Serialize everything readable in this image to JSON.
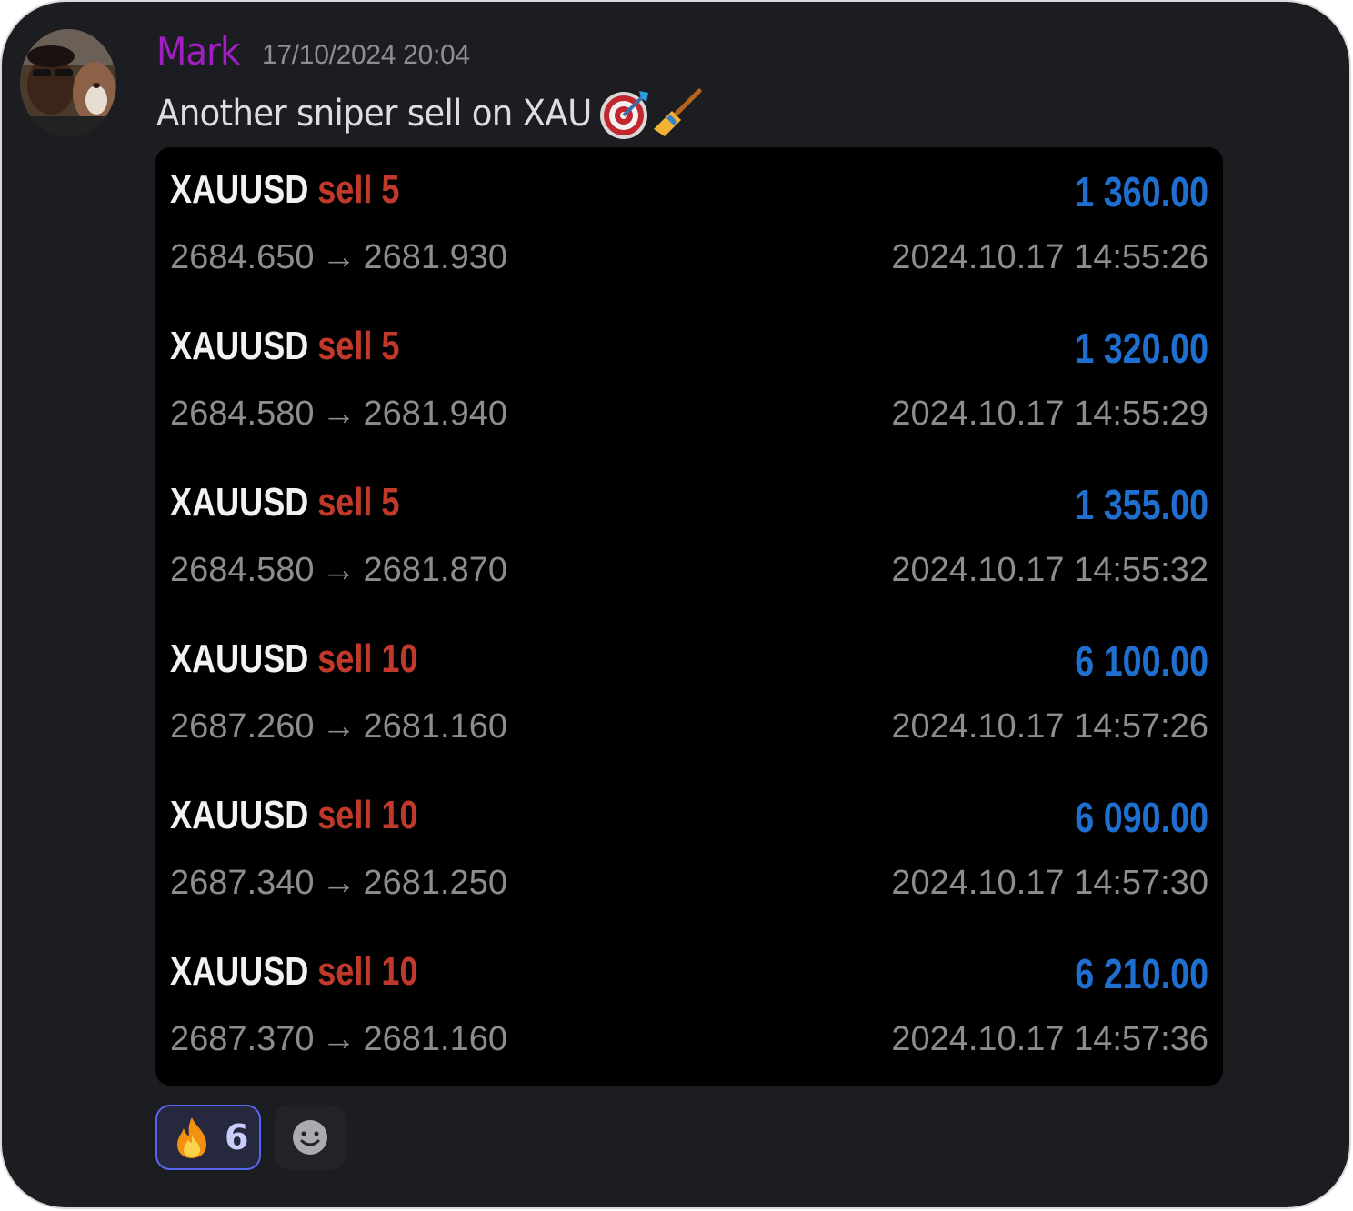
{
  "author": {
    "name": "Mark",
    "timestamp": "17/10/2024 20:04"
  },
  "message": {
    "text": "Another sniper sell on XAU",
    "emojis": [
      "direct-hit-emoji",
      "broom-emoji"
    ]
  },
  "trades": [
    {
      "symbol": "XAUUSD",
      "side": "sell 5",
      "profit": "1 360.00",
      "open": "2684.650",
      "arrow": "→",
      "close": "2681.930",
      "time": "2024.10.17 14:55:26"
    },
    {
      "symbol": "XAUUSD",
      "side": "sell 5",
      "profit": "1 320.00",
      "open": "2684.580",
      "arrow": "→",
      "close": "2681.940",
      "time": "2024.10.17 14:55:29"
    },
    {
      "symbol": "XAUUSD",
      "side": "sell 5",
      "profit": "1 355.00",
      "open": "2684.580",
      "arrow": "→",
      "close": "2681.870",
      "time": "2024.10.17 14:55:32"
    },
    {
      "symbol": "XAUUSD",
      "side": "sell 10",
      "profit": "6 100.00",
      "open": "2687.260",
      "arrow": "→",
      "close": "2681.160",
      "time": "2024.10.17 14:57:26"
    },
    {
      "symbol": "XAUUSD",
      "side": "sell 10",
      "profit": "6 090.00",
      "open": "2687.340",
      "arrow": "→",
      "close": "2681.250",
      "time": "2024.10.17 14:57:30"
    },
    {
      "symbol": "XAUUSD",
      "side": "sell 10",
      "profit": "6 210.00",
      "open": "2687.370",
      "arrow": "→",
      "close": "2681.160",
      "time": "2024.10.17 14:57:36"
    }
  ],
  "reactions": [
    {
      "emoji": "fire-emoji",
      "count": "6",
      "active": true
    }
  ],
  "add_reaction_icon": "smiley-icon",
  "colors": {
    "background": "#1c1d21",
    "username": "#a11ec4",
    "sell": "#c0392b",
    "profit": "#1f6fd1",
    "reaction_border": "#5865f2"
  }
}
